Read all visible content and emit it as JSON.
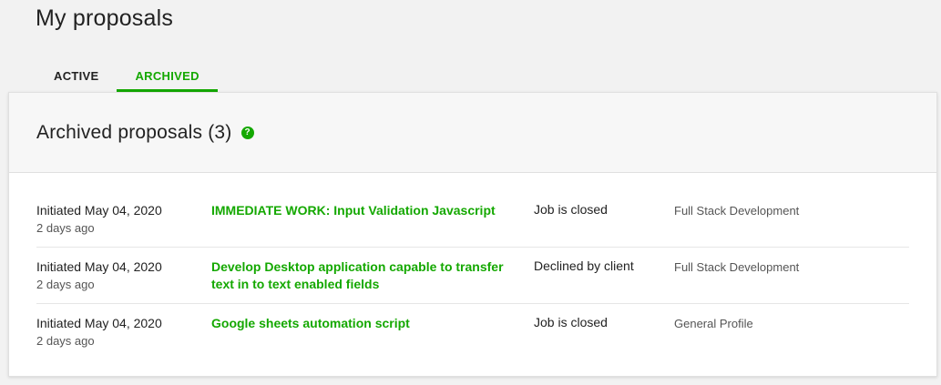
{
  "page": {
    "title": "My proposals"
  },
  "tabs": [
    {
      "label": "ACTIVE",
      "active": false
    },
    {
      "label": "ARCHIVED",
      "active": true
    }
  ],
  "card": {
    "title": "Archived proposals (3)",
    "help_icon": "question-circle-icon"
  },
  "proposals": [
    {
      "date": "Initiated May 04, 2020",
      "ago": "2 days ago",
      "title": "IMMEDIATE WORK: Input Validation Javascript",
      "status": "Job is closed",
      "profile": "Full Stack Development"
    },
    {
      "date": "Initiated May 04, 2020",
      "ago": "2 days ago",
      "title": "Develop Desktop application capable to transfer text in to text enabled fields",
      "status": "Declined by client",
      "profile": "Full Stack Development"
    },
    {
      "date": "Initiated May 04, 2020",
      "ago": "2 days ago",
      "title": "Google sheets automation script",
      "status": "Job is closed",
      "profile": "General Profile"
    }
  ],
  "colors": {
    "accent": "#14a800",
    "background": "#f2f2f2"
  }
}
